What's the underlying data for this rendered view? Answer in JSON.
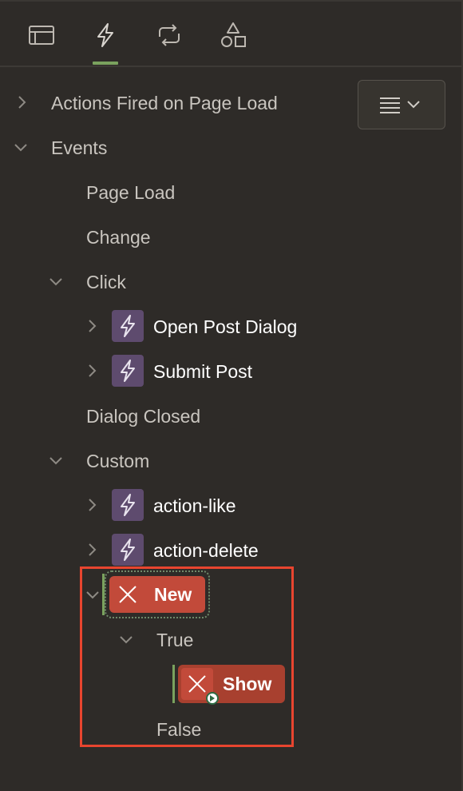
{
  "toolbar": {
    "tabs": [
      {
        "icon": "rendering-icon",
        "active": false
      },
      {
        "icon": "dynamic-actions-icon",
        "active": true
      },
      {
        "icon": "processing-icon",
        "active": false
      },
      {
        "icon": "shared-components-icon",
        "active": false
      }
    ],
    "accent_color": "#7aa25e"
  },
  "tree": {
    "actions_fired_on_page_load": "Actions Fired on Page Load",
    "events": "Events",
    "page_load": "Page Load",
    "change": "Change",
    "click": "Click",
    "open_post_dialog": "Open Post Dialog",
    "submit_post": "Submit Post",
    "dialog_closed": "Dialog Closed",
    "custom": "Custom",
    "action_like": "action-like",
    "action_delete": "action-delete",
    "new": "New",
    "true": "True",
    "show": "Show",
    "false": "False"
  },
  "colors": {
    "background": "#2e2b28",
    "dynamic_action_badge": "#5e4b6e",
    "new_item": "#c24a3a",
    "highlight_box": "#e8452f"
  }
}
